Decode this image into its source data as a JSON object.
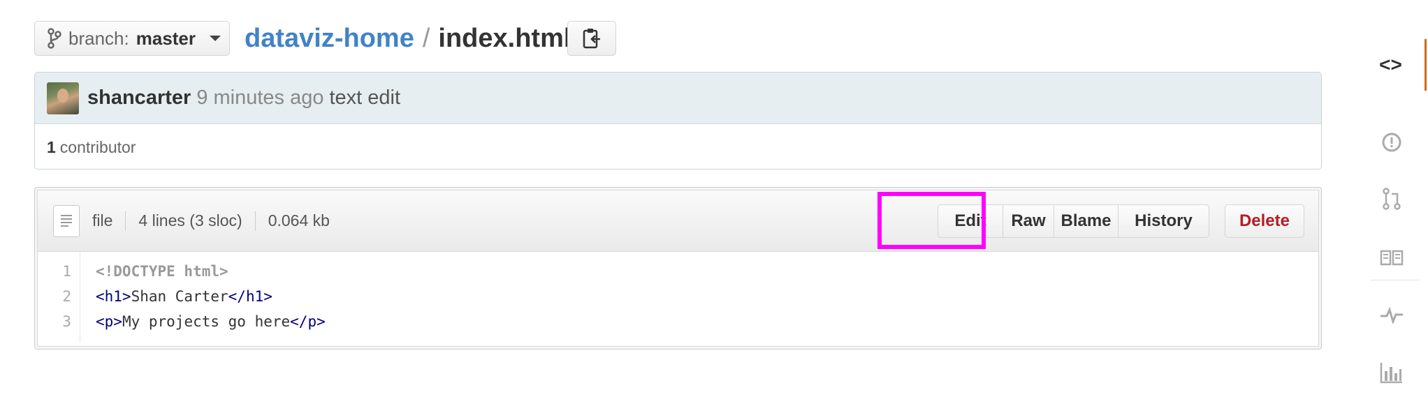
{
  "topbar": {
    "branch_prefix": "branch:",
    "branch_name": "master",
    "repo_name": "dataviz-home",
    "path_separator": "/",
    "file_name": "index.html"
  },
  "commit": {
    "author": "shancarter",
    "time": "9 minutes ago",
    "message": "text edit",
    "contributor_count": "1",
    "contributor_label": "contributor"
  },
  "file": {
    "type": "file",
    "lines": "4 lines (3 sloc)",
    "size": "0.064 kb",
    "buttons": {
      "edit": "Edit",
      "raw": "Raw",
      "blame": "Blame",
      "history": "History",
      "delete": "Delete"
    },
    "code": [
      {
        "num": "1",
        "text": "<!DOCTYPE html>"
      },
      {
        "num": "2",
        "open": "<h1>",
        "content": "Shan Carter",
        "close": "</h1>"
      },
      {
        "num": "3",
        "open": "<p>",
        "content": "My projects go here",
        "close": "</p>"
      }
    ]
  },
  "rail": {
    "code_glyph": "<>",
    "icons": [
      "code-icon",
      "issues-icon",
      "pull-request-icon",
      "wiki-icon",
      "pulse-icon",
      "graphs-icon"
    ]
  },
  "colors": {
    "link": "#4183c4",
    "delete": "#b31d28",
    "highlight": "#ff00ff",
    "rail_active": "#d26911"
  }
}
